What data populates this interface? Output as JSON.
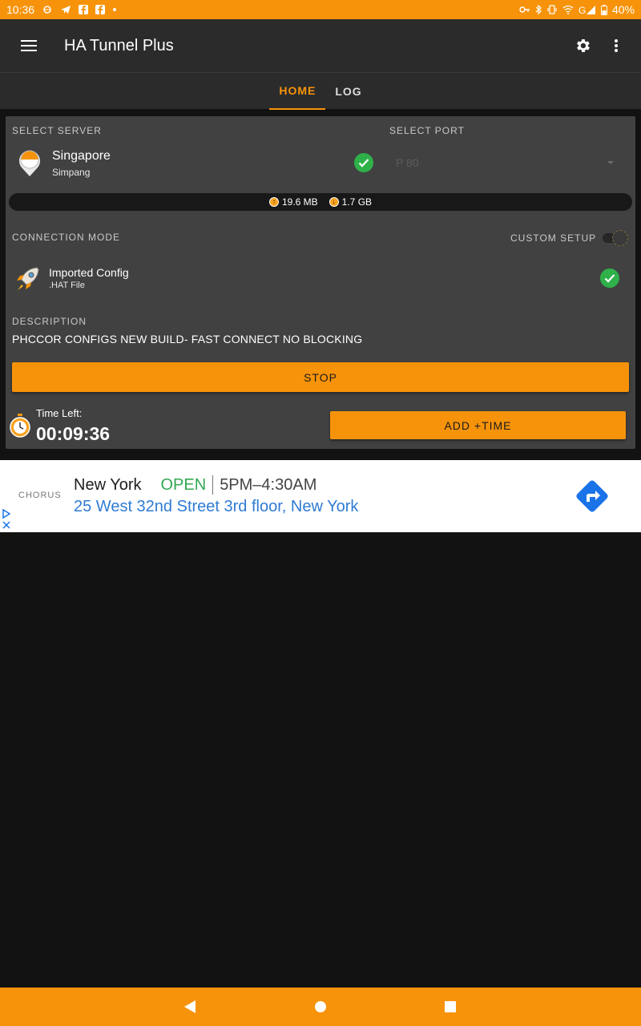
{
  "status_bar": {
    "time": "10:36",
    "battery": "40%"
  },
  "app_bar": {
    "title": "HA Tunnel Plus"
  },
  "tabs": [
    {
      "label": "HOME",
      "active": true
    },
    {
      "label": "LOG",
      "active": false
    }
  ],
  "server": {
    "section_label": "SELECT SERVER",
    "name": "Singapore",
    "subtitle": "Simpang"
  },
  "port": {
    "section_label": "SELECT PORT",
    "value": "P 80"
  },
  "usage": {
    "upload": "19.6 MB",
    "download": "1.7 GB"
  },
  "connection": {
    "section_label": "CONNECTION MODE",
    "custom_setup_label": "CUSTOM SETUP",
    "config_name": "Imported Config",
    "config_type": ".HAT File"
  },
  "description": {
    "label": "DESCRIPTION",
    "text": "PHCCOR CONFIGS NEW BUILD- FAST CONNECT NO BLOCKING"
  },
  "stop_button": "STOP",
  "timer": {
    "label": "Time Left:",
    "value": "00:09:36"
  },
  "add_time_button": "ADD +TIME",
  "ad": {
    "logo": "CHORUS",
    "city": "New York",
    "status": "OPEN",
    "hours": "5PM–4:30AM",
    "address": "25 West 32nd Street 3rd floor, New York"
  },
  "colors": {
    "accent": "#f7930a",
    "surface": "#414141",
    "background": "#121212",
    "success": "#2fb14a"
  }
}
